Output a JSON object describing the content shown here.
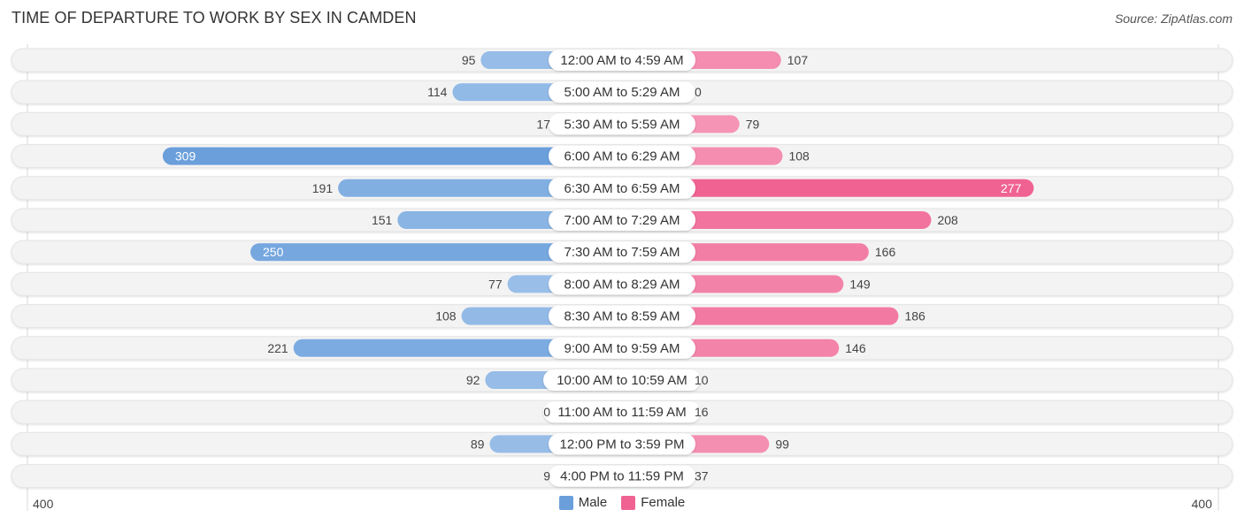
{
  "header": {
    "title": "TIME OF DEPARTURE TO WORK BY SEX IN CAMDEN",
    "source": "Source: ZipAtlas.com"
  },
  "axis": {
    "left_label": "400",
    "right_label": "400"
  },
  "legend": {
    "male_label": "Male",
    "female_label": "Female"
  },
  "colors": {
    "male": "#6a9fdc",
    "male_light": "#a9c9ec",
    "female": "#f06292",
    "female_light": "#f7a8c2",
    "track": "#f3f3f3"
  },
  "chart_data": {
    "type": "bar",
    "orientation": "horizontal-diverging",
    "title": "TIME OF DEPARTURE TO WORK BY SEX IN CAMDEN",
    "xlabel": "",
    "ylabel": "",
    "xlim": [
      -400,
      400
    ],
    "legend_position": "bottom-center",
    "grid": false,
    "categories": [
      "12:00 AM to 4:59 AM",
      "5:00 AM to 5:29 AM",
      "5:30 AM to 5:59 AM",
      "6:00 AM to 6:29 AM",
      "6:30 AM to 6:59 AM",
      "7:00 AM to 7:29 AM",
      "7:30 AM to 7:59 AM",
      "8:00 AM to 8:29 AM",
      "8:30 AM to 8:59 AM",
      "9:00 AM to 9:59 AM",
      "10:00 AM to 10:59 AM",
      "11:00 AM to 11:59 AM",
      "12:00 PM to 3:59 PM",
      "4:00 PM to 11:59 PM"
    ],
    "series": [
      {
        "name": "Male",
        "side": "left",
        "values": [
          95,
          114,
          17,
          309,
          191,
          151,
          250,
          77,
          108,
          221,
          92,
          0,
          89,
          9
        ]
      },
      {
        "name": "Female",
        "side": "right",
        "values": [
          107,
          0,
          79,
          108,
          277,
          208,
          166,
          149,
          186,
          146,
          10,
          16,
          99,
          37
        ]
      }
    ]
  }
}
